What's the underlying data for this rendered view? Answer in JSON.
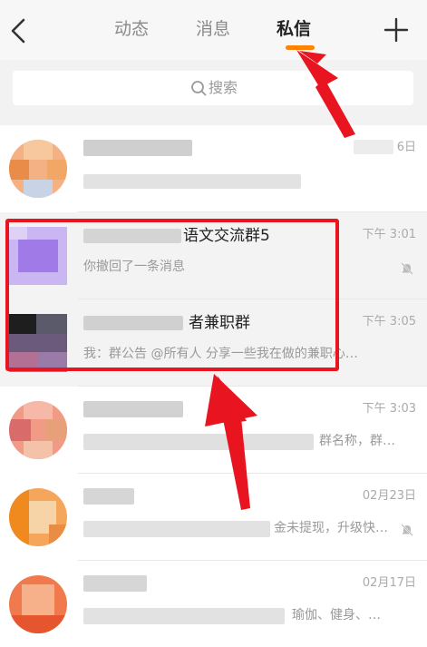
{
  "header": {
    "tabs": [
      {
        "label": "动态",
        "active": false
      },
      {
        "label": "消息",
        "active": false
      },
      {
        "label": "私信",
        "active": true
      }
    ],
    "accent": "#ff8200"
  },
  "search": {
    "placeholder": "搜索"
  },
  "conversations": [
    {
      "title": "",
      "preview": "",
      "time": "6日"
    },
    {
      "title": "语文交流群5",
      "preview": "你撤回了一条消息",
      "time": "下午 3:01",
      "muted": true
    },
    {
      "title": "者兼职群",
      "preview": "我：群公告 @所有人 分享一些我在做的兼职心…",
      "time": "下午 3:05"
    },
    {
      "title": "",
      "preview": "群名称，群…",
      "time": "下午 3:03"
    },
    {
      "title": "",
      "preview": "金未提现，升级快…",
      "time": "02月23日"
    },
    {
      "title": "",
      "preview": "瑜伽、健身、…",
      "time": "02月17日"
    }
  ],
  "annotation": {
    "box_color": "#e8141f",
    "arrow_color": "#e8141f"
  }
}
